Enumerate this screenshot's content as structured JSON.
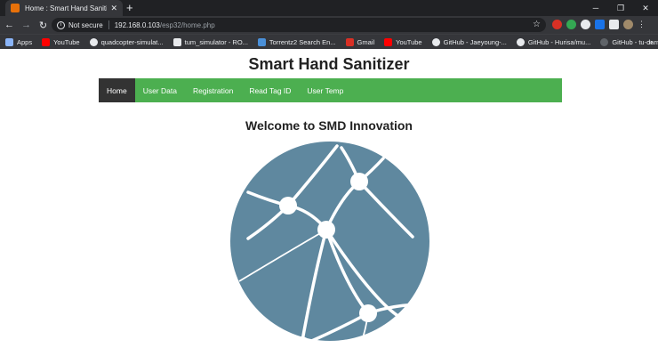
{
  "browser": {
    "tab_title": "Home : Smart Hand Sanitizer",
    "security_label": "Not secure",
    "url_host": "192.168.0.103",
    "url_path": "/esp32/home.php",
    "bookmarks": [
      {
        "label": "Apps",
        "color": "#5f6368"
      },
      {
        "label": "YouTube",
        "color": "#ff0000"
      },
      {
        "label": "quadcopter-simulat...",
        "color": "#e8eaed"
      },
      {
        "label": "tum_simulator - RO...",
        "color": "#e8eaed"
      },
      {
        "label": "Torrentz2 Search En...",
        "color": "#4a90d9"
      },
      {
        "label": "Gmail",
        "color": "#d93025"
      },
      {
        "label": "YouTube",
        "color": "#ff0000"
      },
      {
        "label": "GitHub - Jaeyoung-...",
        "color": "#e8eaed"
      },
      {
        "label": "GitHub - Hurisa/mu...",
        "color": "#e8eaed"
      },
      {
        "label": "GitHub - tu-darmst...",
        "color": "#e8eaed"
      }
    ]
  },
  "site": {
    "title": "Smart Hand Sanitizer",
    "nav": [
      {
        "label": "Home",
        "active": true
      },
      {
        "label": "User Data",
        "active": false
      },
      {
        "label": "Registration",
        "active": false
      },
      {
        "label": "Read Tag ID",
        "active": false
      },
      {
        "label": "User Temp",
        "active": false
      }
    ],
    "welcome": "Welcome to SMD Innovation",
    "accent_color": "#4caf50",
    "logo_color": "#5f889f"
  }
}
